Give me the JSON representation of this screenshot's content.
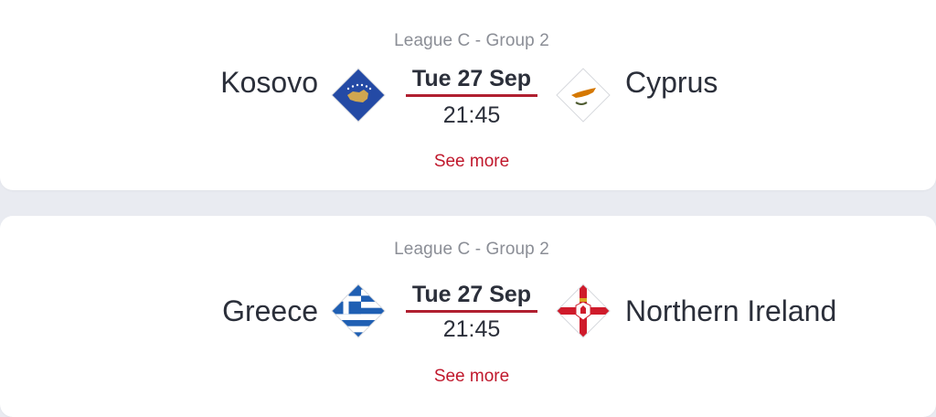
{
  "matches": [
    {
      "group": "League C - Group 2",
      "home": {
        "name": "Kosovo",
        "flag_icon": "kosovo-flag-icon"
      },
      "away": {
        "name": "Cyprus",
        "flag_icon": "cyprus-flag-icon"
      },
      "date": "Tue 27 Sep",
      "time": "21:45",
      "link": "See more"
    },
    {
      "group": "League C - Group 2",
      "home": {
        "name": "Greece",
        "flag_icon": "greece-flag-icon"
      },
      "away": {
        "name": "Northern Ireland",
        "flag_icon": "northern-ireland-flag-icon"
      },
      "date": "Tue 27 Sep",
      "time": "21:45",
      "link": "See more"
    }
  ],
  "colors": {
    "accent": "#c0182c",
    "underline": "#b01f30",
    "text": "#2b2f3a",
    "muted": "#8b8e96",
    "background": "#e9ebf1"
  }
}
